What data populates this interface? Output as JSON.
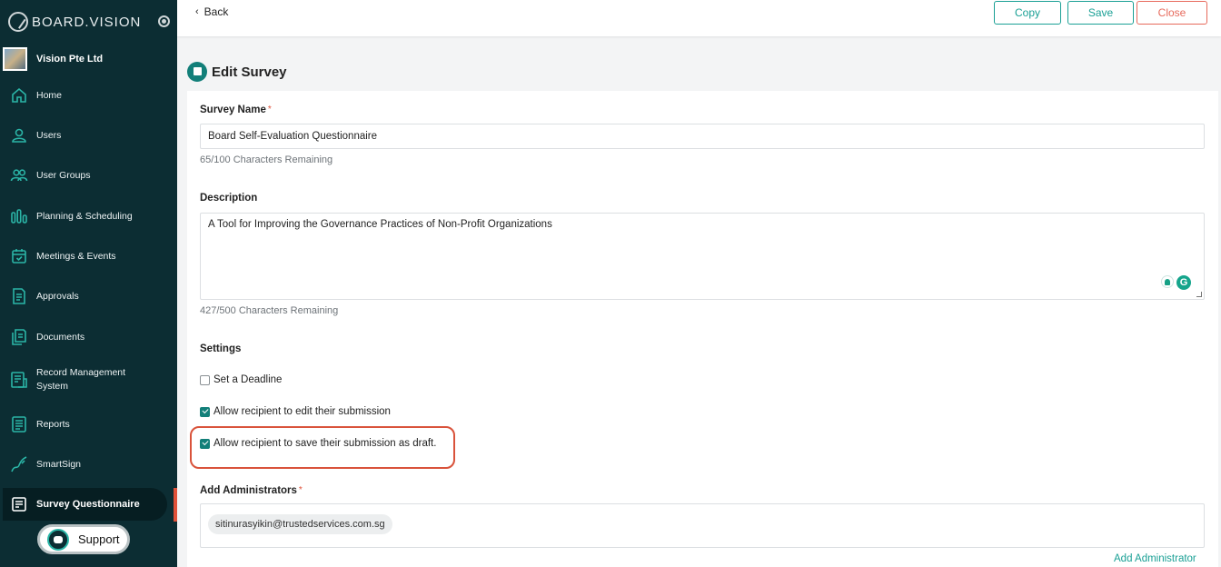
{
  "brand": {
    "name": "BOARD.VISION",
    "org_name": "Vision Pte Ltd"
  },
  "sidebar": {
    "items": [
      {
        "label": "Home",
        "icon": "home-icon"
      },
      {
        "label": "Users",
        "icon": "user-icon"
      },
      {
        "label": "User Groups",
        "icon": "user-groups-icon"
      },
      {
        "label": "Planning & Scheduling",
        "icon": "planning-icon"
      },
      {
        "label": "Meetings & Events",
        "icon": "calendar-icon"
      },
      {
        "label": "Approvals",
        "icon": "approvals-icon"
      },
      {
        "label": "Documents",
        "icon": "documents-icon"
      },
      {
        "label": "Record Management System",
        "icon": "records-icon"
      },
      {
        "label": "Reports",
        "icon": "reports-icon"
      },
      {
        "label": "SmartSign",
        "icon": "smartsign-icon"
      },
      {
        "label": "Survey Questionnaire",
        "icon": "survey-icon",
        "active": true
      }
    ],
    "support_label": "Support"
  },
  "topbar": {
    "back_label": "Back",
    "copy_label": "Copy",
    "save_label": "Save",
    "close_label": "Close"
  },
  "page": {
    "title": "Edit Survey"
  },
  "form": {
    "survey_name": {
      "label": "Survey Name",
      "required_mark": "*",
      "value": "Board Self-Evaluation Questionnaire",
      "remaining": "65/100 Characters Remaining"
    },
    "description": {
      "label": "Description",
      "value": "A Tool for Improving the Governance Practices of Non-Profit Organizations",
      "remaining": "427/500 Characters Remaining"
    },
    "settings": {
      "label": "Settings",
      "options": [
        {
          "label": "Set a Deadline",
          "checked": false
        },
        {
          "label": "Allow recipient to edit their submission",
          "checked": true
        },
        {
          "label": "Allow recipient to save their submission as draft.",
          "checked": true
        }
      ]
    },
    "administrators": {
      "label": "Add Administrators",
      "required_mark": "*",
      "chips": [
        "sitinurasyikin@trustedservices.com.sg"
      ],
      "add_label": "Add Administrator"
    }
  },
  "colors": {
    "sidebar_bg": "#0c2d33",
    "accent": "#1aa095",
    "danger": "#e76a5c",
    "highlight": "#d9533b"
  }
}
